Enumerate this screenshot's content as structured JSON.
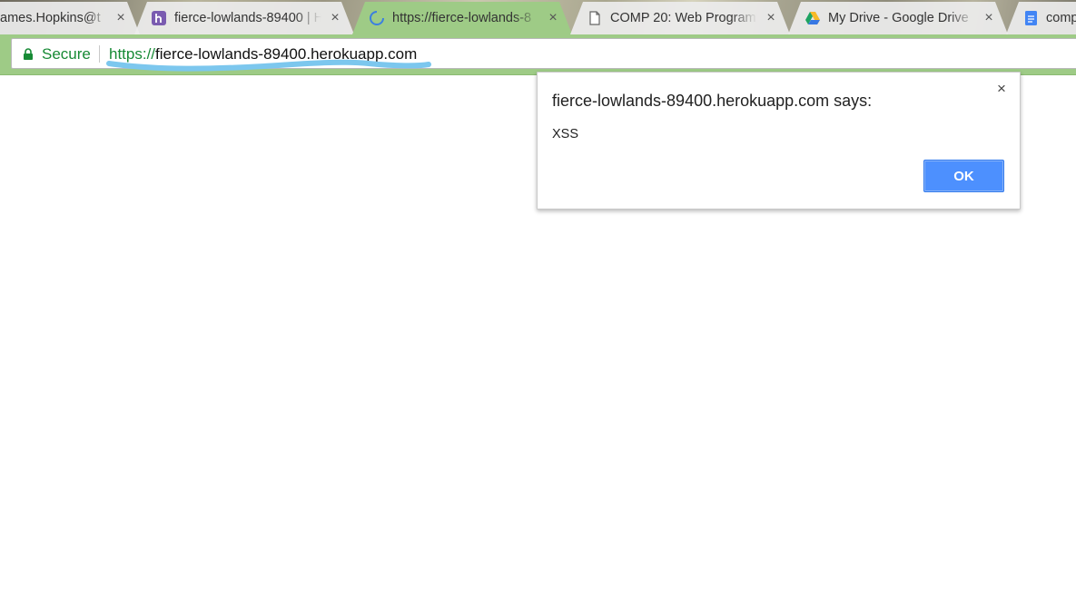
{
  "browser": {
    "tabs": [
      {
        "title": "ames.Hopkins@t",
        "favicon": "none",
        "active": false
      },
      {
        "title": "fierce-lowlands-89400 | H",
        "favicon": "heroku-icon",
        "active": false
      },
      {
        "title": "https://fierce-lowlands-8",
        "favicon": "loading-spinner-icon",
        "active": true
      },
      {
        "title": "COMP 20: Web Programm",
        "favicon": "document-icon",
        "active": false
      },
      {
        "title": "My Drive - Google Drive",
        "favicon": "google-drive-icon",
        "active": false
      },
      {
        "title": "comp",
        "favicon": "google-docs-icon",
        "active": false
      }
    ],
    "tab_close_glyph": "×",
    "omnibox": {
      "secure_label": "Secure",
      "url_scheme": "https://",
      "url_host": "fierce-lowlands-89400.herokuapp.com"
    }
  },
  "dialog": {
    "title": "fierce-lowlands-89400.herokuapp.com says:",
    "message": "XSS",
    "ok_label": "OK",
    "close_glyph": "×"
  },
  "colors": {
    "toolbar": "#9ecb86",
    "secure_green": "#178a35",
    "ok_button": "#4d90fe",
    "scribble": "#7cc7ee"
  }
}
